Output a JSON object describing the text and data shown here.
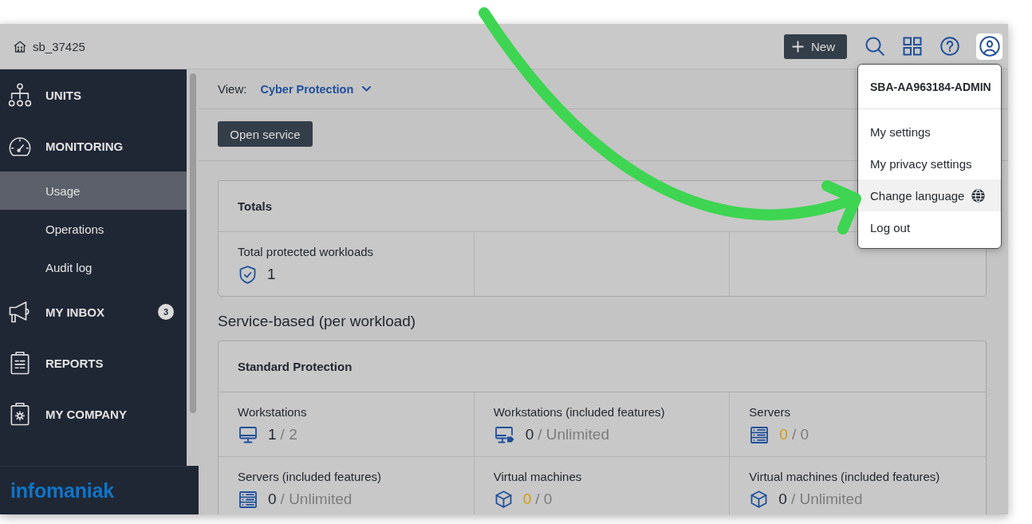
{
  "top_bar": {
    "account": "sb_37425",
    "new_button": "New"
  },
  "account_menu": {
    "open": true,
    "user": "SBA-AA963184-ADMIN",
    "items": [
      {
        "label": "My settings",
        "kind": "plain",
        "highlighted": false
      },
      {
        "label": "My privacy settings",
        "kind": "plain",
        "highlighted": false
      },
      {
        "label": "Change language",
        "kind": "language",
        "highlighted": true
      },
      {
        "label": "Log out",
        "kind": "plain",
        "highlighted": false
      }
    ]
  },
  "sidebar": {
    "items": [
      {
        "label": "UNITS",
        "kind": "units",
        "selected": false
      },
      {
        "label": "MONITORING",
        "kind": "monitoring",
        "selected": false,
        "children": [
          {
            "label": "Usage",
            "selected": true
          },
          {
            "label": "Operations",
            "selected": false
          },
          {
            "label": "Audit log",
            "selected": false
          }
        ]
      },
      {
        "label": "MY INBOX",
        "kind": "inbox",
        "badge": "3",
        "selected": false
      },
      {
        "label": "REPORTS",
        "kind": "reports",
        "selected": false
      },
      {
        "label": "MY COMPANY",
        "kind": "company",
        "selected": false
      }
    ],
    "logo": "infomaniak"
  },
  "view": {
    "label": "View:",
    "value": "Cyber Protection"
  },
  "open_service_button": "Open service",
  "totals": {
    "title": "Totals",
    "cells": [
      {
        "label": "Total protected workloads",
        "kind": "workloads",
        "used": "1",
        "warning": false
      }
    ]
  },
  "section_title": "Service-based (per workload)",
  "standard_protection": {
    "title": "Standard Protection",
    "cells": [
      {
        "label": "Workstations",
        "kind": "workstation",
        "used": "1",
        "quota": "/ 2",
        "warning": false
      },
      {
        "label": "Workstations (included features)",
        "kind": "workstation_tag",
        "used": "0",
        "quota": "/ Unlimited",
        "warning": false
      },
      {
        "label": "Servers",
        "kind": "server",
        "used": "0",
        "quota": "/ 0",
        "warning": true
      },
      {
        "label": "Servers (included features)",
        "kind": "server",
        "used": "0",
        "quota": "/ Unlimited",
        "warning": false
      },
      {
        "label": "Virtual machines",
        "kind": "vm",
        "used": "0",
        "quota": "/ 0",
        "warning": true
      },
      {
        "label": "Virtual machines (included features)",
        "kind": "vm",
        "used": "0",
        "quota": "/ Unlimited",
        "warning": false
      }
    ]
  }
}
